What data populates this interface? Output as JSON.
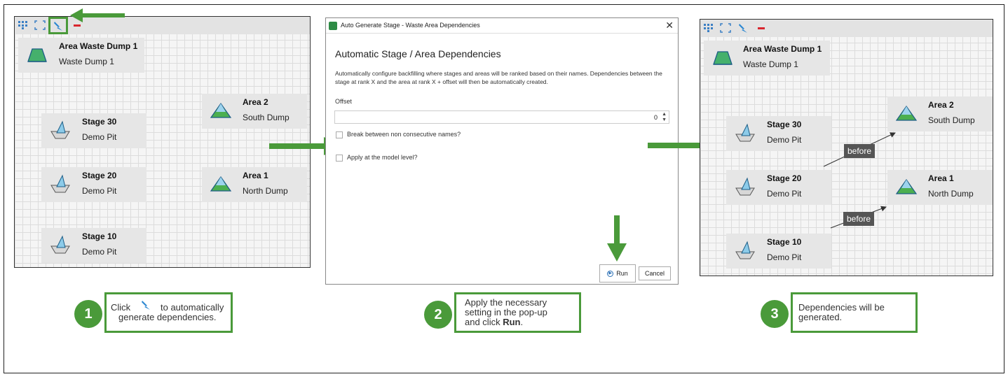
{
  "colors": {
    "accent_green": "#4a9a3a",
    "grid_bg": "#f5f5f5",
    "node_bg": "#e6e6e6"
  },
  "toolbar_icons": [
    "layout-icon",
    "fit-screen-icon",
    "auto-generate-icon",
    "remove-icon"
  ],
  "panel1": {
    "nodes": [
      {
        "title": "Area Waste Dump 1",
        "subtitle": "Waste Dump 1",
        "icon": "area-icon"
      },
      {
        "title": "Area 2",
        "subtitle": "South Dump",
        "icon": "dump-icon"
      },
      {
        "title": "Stage 30",
        "subtitle": "Demo Pit",
        "icon": "stage-icon"
      },
      {
        "title": "Stage 20",
        "subtitle": "Demo Pit",
        "icon": "stage-icon"
      },
      {
        "title": "Area 1",
        "subtitle": "North Dump",
        "icon": "dump-icon"
      },
      {
        "title": "Stage 10",
        "subtitle": "Demo Pit",
        "icon": "stage-icon"
      }
    ]
  },
  "dialog": {
    "window_title": "Auto Generate Stage - Waste Area Dependencies",
    "heading": "Automatic Stage / Area Dependencies",
    "description": "Automatically configure backfilling where stages and areas will be ranked based on their names. Dependencies between the stage at rank X and the area at rank X + offset will then be automatically created.",
    "offset_label": "Offset",
    "offset_value": "0",
    "break_label": "Break between non consecutive names?",
    "apply_label": "Apply at the model level?",
    "run_label": "Run",
    "cancel_label": "Cancel"
  },
  "panel3": {
    "nodes": [
      {
        "title": "Area Waste Dump 1",
        "subtitle": "Waste Dump 1"
      },
      {
        "title": "Area 2",
        "subtitle": "South Dump"
      },
      {
        "title": "Stage 30",
        "subtitle": "Demo Pit"
      },
      {
        "title": "Stage 20",
        "subtitle": "Demo Pit"
      },
      {
        "title": "Area 1",
        "subtitle": "North Dump"
      },
      {
        "title": "Stage 10",
        "subtitle": "Demo Pit"
      }
    ],
    "before_label": "before"
  },
  "steps": [
    {
      "number": "1",
      "text_a": "Click",
      "text_b": "to automatically",
      "text_c": "generate dependencies."
    },
    {
      "number": "2",
      "line1": "Apply the necessary",
      "line2": "setting in the pop-up",
      "line3": "and click ",
      "bold": "Run",
      "end": "."
    },
    {
      "number": "3",
      "line1": "Dependencies will be",
      "line2": "generated."
    }
  ]
}
